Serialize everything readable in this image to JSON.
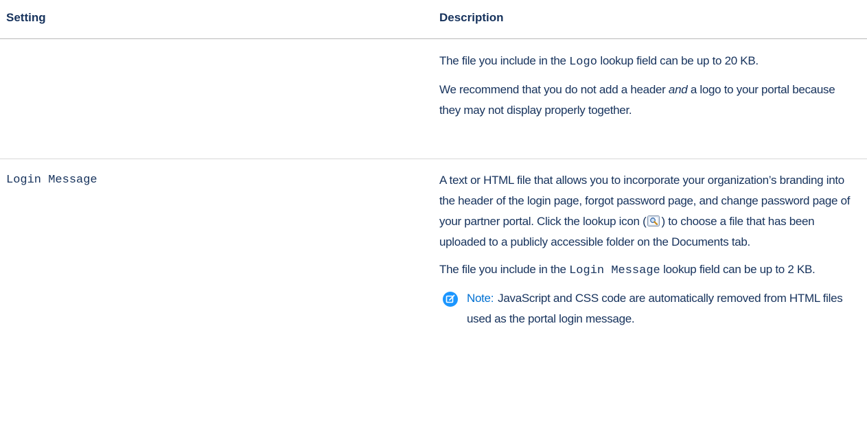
{
  "table": {
    "headers": {
      "setting": "Setting",
      "description": "Description"
    },
    "rows": [
      {
        "setting": "",
        "paragraphs": [
          {
            "pre": "The file you include in the ",
            "code": "Logo",
            "post": " lookup field can be up to 20 KB."
          },
          {
            "pre": "We recommend that you do not add a header ",
            "em": "and",
            "post": " a logo to your portal because they may not display properly together."
          }
        ]
      },
      {
        "setting": "Login Message",
        "paragraphs": [
          {
            "pre": "A text or HTML file that allows you to incorporate your organization’s branding into the header of the login page, forgot password page, and change password page of your partner portal. Click the lookup icon (",
            "icon": "lookup-icon",
            "post": ") to choose a file that has been uploaded to a publicly accessible folder on the Documents tab."
          },
          {
            "pre": "The file you include in the ",
            "code": "Login Message",
            "post": " lookup field can be up to 2 KB."
          }
        ],
        "note": {
          "icon": "note-edit-icon",
          "label": "Note:",
          "text": "JavaScript and CSS code are automatically removed from HTML files used as the portal login message."
        }
      }
    ]
  },
  "colors": {
    "text": "#16325c",
    "note_accent": "#0070d2",
    "divider": "#d8d8d8"
  }
}
